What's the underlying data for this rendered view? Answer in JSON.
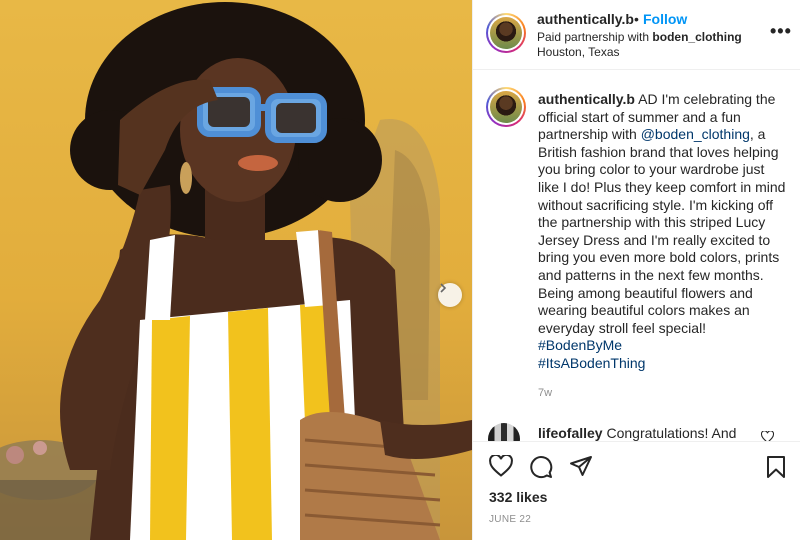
{
  "post": {
    "username": "authentically.b",
    "follow_label": "Follow",
    "separator": "•",
    "partnership_prefix": "Paid partnership with ",
    "partner": "boden_clothing",
    "location": "Houston, Texas",
    "more_label": "•••"
  },
  "caption": {
    "username": "authentically.b",
    "text_1": " AD I'm celebrating the official start of summer and a fun partnership with ",
    "mention": "@boden_clothing",
    "text_2": ", a British fashion brand that loves helping you bring color to your wardrobe just like I do! Plus they keep comfort in mind without sacrificing style. I'm kicking off the partnership with this striped Lucy Jersey Dress and I'm really excited to bring you even more bold colors, prints and patterns in the next few months. Being among beautiful flowers and wearing beautiful colors makes an everyday stroll feel special! ",
    "hashtag_1": "#BodenByMe",
    "hashtag_2": "#ItsABodenThing",
    "age": "7w"
  },
  "comment": {
    "username": "lifeofalley",
    "text": " Congratulations! And"
  },
  "footer": {
    "likes": "332 likes",
    "date": "JUNE 22"
  },
  "icons": {
    "like": "heart-icon",
    "comment": "comment-icon",
    "share": "share-icon",
    "save": "bookmark-icon",
    "next": "chevron-right-icon"
  },
  "colors": {
    "follow": "#0095f6",
    "link": "#00376b",
    "muted": "#8e8e8e"
  }
}
